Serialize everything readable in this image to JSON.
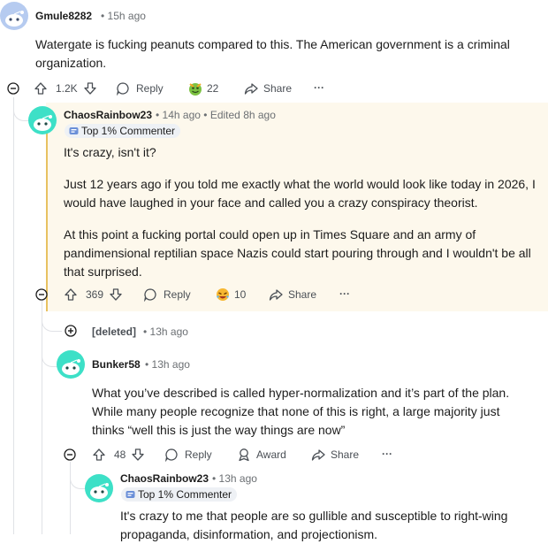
{
  "comments": [
    {
      "username": "Gmule8282",
      "time": "15h ago",
      "body": [
        "Watergate is fucking peanuts compared to this. The American government is a criminal organization."
      ],
      "votes": "1.2K",
      "reply_label": "Reply",
      "award_count": "22",
      "share_label": "Share",
      "more": "···"
    },
    {
      "username": "ChaosRainbow23",
      "time": "14h ago",
      "edited": "Edited 8h ago",
      "badge": "Top 1% Commenter",
      "body": [
        "It's crazy, isn't it?",
        "Just 12 years ago if you told me exactly what the world would look like today in 2026, I would have laughed in your face and called you a crazy conspiracy theorist.",
        "At this point a fucking portal could open up in Times Square and an army of pandimensional reptilian space Nazis could start pouring through and I wouldn't be all that surprised."
      ],
      "votes": "369",
      "reply_label": "Reply",
      "award_count": "10",
      "share_label": "Share",
      "more": "···"
    },
    {
      "username": "[deleted]",
      "time": "13h ago"
    },
    {
      "username": "Bunker58",
      "time": "13h ago",
      "body": [
        "What you’ve described is called hyper-normalization and it’s part of the plan. While many people recognize that none of this is right, a large majority just thinks “well this is just the way things are now”"
      ],
      "votes": "48",
      "reply_label": "Reply",
      "award_label": "Award",
      "share_label": "Share",
      "more": "···"
    },
    {
      "username": "ChaosRainbow23",
      "time": "13h ago",
      "badge": "Top 1% Commenter",
      "body": [
        "It's crazy to me that people are so gullible and susceptible to right-wing propaganda, disinformation, and projectionism."
      ]
    }
  ],
  "separator": "•",
  "colors": {
    "avatar_bg": "#b6cbf0",
    "avatar_green": "#3de0c7",
    "highlight": "#fdf8ec",
    "highlight_bar": "#e8c261",
    "thread_line": "#e0e2e6"
  },
  "icons": {
    "upvote": "arrow-up-icon",
    "downvote": "arrow-down-icon",
    "reply": "speech-bubble-icon",
    "share": "share-arrow-icon",
    "award": "award-icon",
    "collapse": "minus-circle-icon",
    "expand": "plus-circle-icon"
  }
}
